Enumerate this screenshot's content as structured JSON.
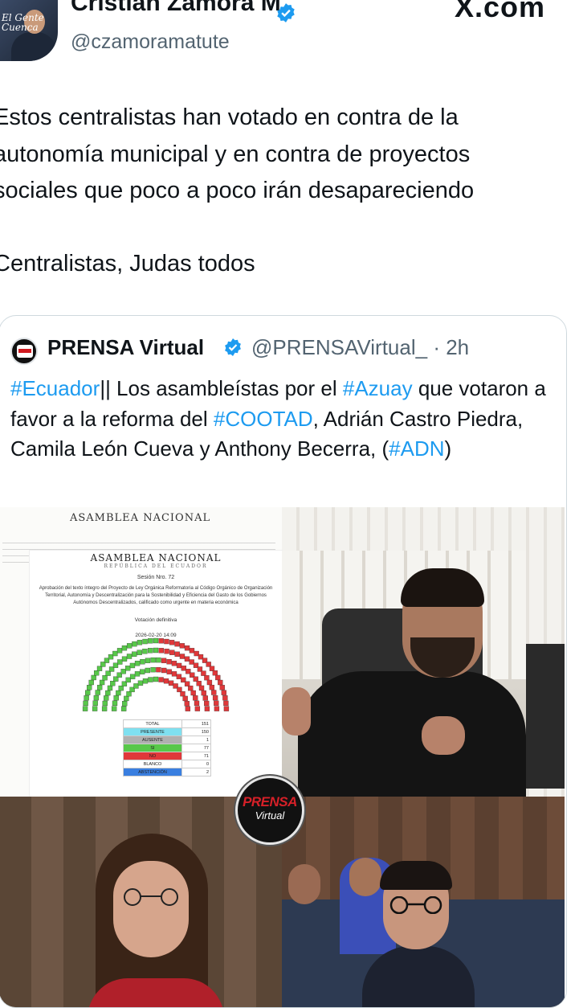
{
  "tweet": {
    "author_name": "Cristian Zamora M",
    "author_handle": "@czamoramatute",
    "avatar_overlay_text": "El Gente\nCuenca",
    "source_site": "X.com",
    "text": "Estos centralistas han votado en contra de la\nautonomía municipal y en contra de proyectos\nsociales que poco a poco irán desapareciendo\n\nCentralistas, Judas todos"
  },
  "quote": {
    "author_name": "PRENSA Virtual",
    "author_handle": "@PRENSAVirtual_",
    "time": "· 2h",
    "text_segments": [
      {
        "text": "#Ecuador",
        "tag": true
      },
      {
        "text": "|| Los asambleístas por el ",
        "tag": false
      },
      {
        "text": "#Azuay",
        "tag": true
      },
      {
        "text": " que votaron a favor a la reforma del ",
        "tag": false
      },
      {
        "text": "#COOTAD",
        "tag": true
      },
      {
        "text": ", Adrián Castro Piedra, Camila León Cueva y Anthony Becerra, (",
        "tag": false
      },
      {
        "text": "#ADN",
        "tag": true
      },
      {
        "text": ")",
        "tag": false
      }
    ]
  },
  "document": {
    "title": "ASAMBLEA NACIONAL",
    "subtitle": "REPÚBLICA DEL ECUADOR",
    "session": "Sesión Nro. 72",
    "description": "Aprobación del texto íntegro del Proyecto de Ley Orgánica Reformatoria al Código Orgánico de Organización Territorial, Autonomía y Descentralización para la Sostenibilidad y Eficiencia del Gasto de los Gobiernos Autónomos Descentralizados, calificado como urgente en materia económica",
    "vote_type": "Votación definitiva",
    "datetime": "2026-02-20 14:09",
    "results": [
      {
        "label": "TOTAL",
        "value": "151",
        "color": "#ffffff"
      },
      {
        "label": "PRESENTE",
        "value": "150",
        "color": "#7fe0f0"
      },
      {
        "label": "AUSENTE",
        "value": "1",
        "color": "#b0b0b0"
      },
      {
        "label": "SI",
        "value": "77",
        "color": "#58c84a"
      },
      {
        "label": "NO",
        "value": "71",
        "color": "#e0383a"
      },
      {
        "label": "BLANCO",
        "value": "0",
        "color": "#ffffff"
      },
      {
        "label": "ABSTENCIÓN",
        "value": "2",
        "color": "#3a7fe0"
      }
    ]
  },
  "media_logo": {
    "line1": "PRENSA",
    "line2": "Virtual"
  },
  "colors": {
    "link": "#1d9bf0",
    "verified": "#1d9bf0",
    "muted": "#536471",
    "border": "#cfd9de"
  }
}
